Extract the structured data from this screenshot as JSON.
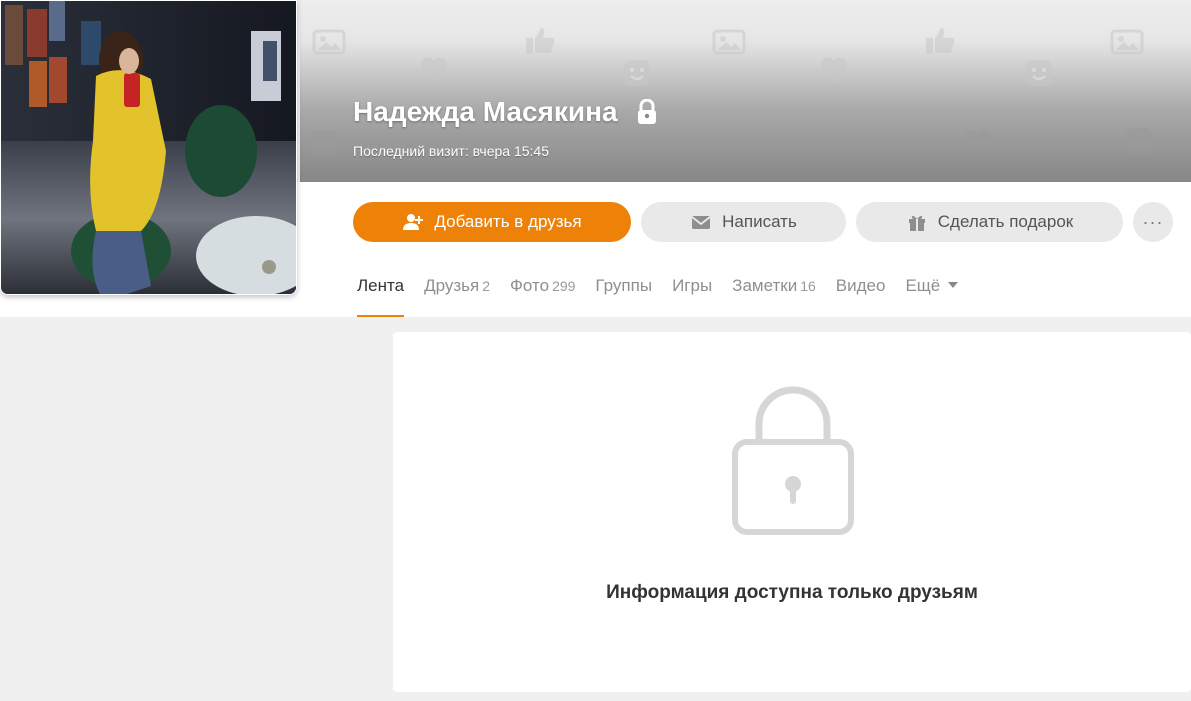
{
  "profile": {
    "name": "Надежда Масякина",
    "last_visit": "Последний визит: вчера 15:45",
    "avatar_alt": "profile-photo"
  },
  "actions": {
    "add_friend": "Добавить в друзья",
    "message": "Написать",
    "gift": "Сделать подарок",
    "more": "···"
  },
  "tabs": [
    {
      "label": "Лента",
      "count": ""
    },
    {
      "label": "Друзья",
      "count": "2"
    },
    {
      "label": "Фото",
      "count": "299"
    },
    {
      "label": "Группы",
      "count": ""
    },
    {
      "label": "Игры",
      "count": ""
    },
    {
      "label": "Заметки",
      "count": "16"
    },
    {
      "label": "Видео",
      "count": ""
    },
    {
      "label": "Ещё",
      "count": ""
    }
  ],
  "active_tab": "Лента",
  "private_notice": "Информация доступна только друзьям",
  "colors": {
    "accent": "#ee8208",
    "button_gray": "#e9e9e9",
    "page_bg": "#f0f0f0"
  },
  "icons": {
    "add_friend": "add-user-icon",
    "message": "envelope-icon",
    "gift": "gift-icon",
    "private": "lock-icon",
    "more_tabs": "chevron-down-icon"
  }
}
